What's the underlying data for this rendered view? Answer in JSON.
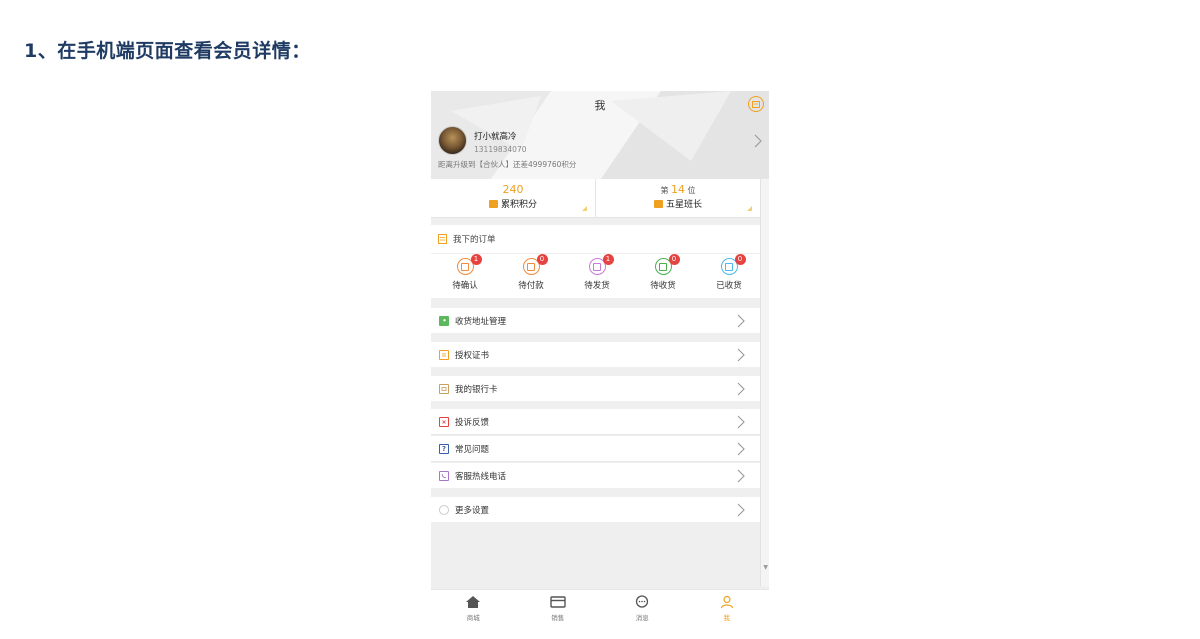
{
  "heading": "1、在手机端页面查看会员详情：",
  "page_title": "我",
  "user": {
    "name": "打小就高冷",
    "phone": "13119834070",
    "upgrade_tip": "距离升级到【合伙人】还差4999760积分"
  },
  "stats": {
    "points_value": "240",
    "points_label": "累积积分",
    "rank_prefix": "第",
    "rank_value": "14",
    "rank_suffix": "位",
    "rank_title": "五星班长"
  },
  "orders": {
    "title": "我下的订单",
    "items": [
      {
        "label": "待确认",
        "count": "1",
        "color": "#f08a3c",
        "icon": "confirm-icon"
      },
      {
        "label": "待付款",
        "count": "0",
        "color": "#f08a3c",
        "icon": "payment-icon"
      },
      {
        "label": "待发货",
        "count": "1",
        "color": "#c97ad6",
        "icon": "shipping-icon"
      },
      {
        "label": "待收货",
        "count": "0",
        "color": "#4caf50",
        "icon": "receiving-icon"
      },
      {
        "label": "已收货",
        "count": "0",
        "color": "#4fb6e8",
        "icon": "received-icon"
      }
    ]
  },
  "menu": [
    {
      "label": "收货地址管理",
      "icon": "location-icon",
      "color": "#5cb85c"
    },
    {
      "label": "授权证书",
      "icon": "certificate-icon",
      "color": "#f0a020"
    },
    {
      "label": "我的银行卡",
      "icon": "bank-card-icon",
      "color": "#c8a060"
    },
    {
      "label": "投诉反馈",
      "icon": "feedback-icon",
      "color": "#e64340"
    },
    {
      "label": "常见问题",
      "icon": "question-icon",
      "color": "#3a5fa8"
    },
    {
      "label": "客服热线电话",
      "icon": "phone-icon",
      "color": "#a875c8"
    },
    {
      "label": "更多设置",
      "icon": "settings-icon",
      "color": "#bbbbbb"
    }
  ],
  "tabs": [
    {
      "label": "商城",
      "icon": "home-icon"
    },
    {
      "label": "销售",
      "icon": "card-icon"
    },
    {
      "label": "消息",
      "icon": "message-icon"
    },
    {
      "label": "我",
      "icon": "user-icon",
      "active": true
    }
  ],
  "colors": {
    "accent": "#f0a020",
    "badge": "#e64340",
    "heading": "#1f3b63"
  }
}
